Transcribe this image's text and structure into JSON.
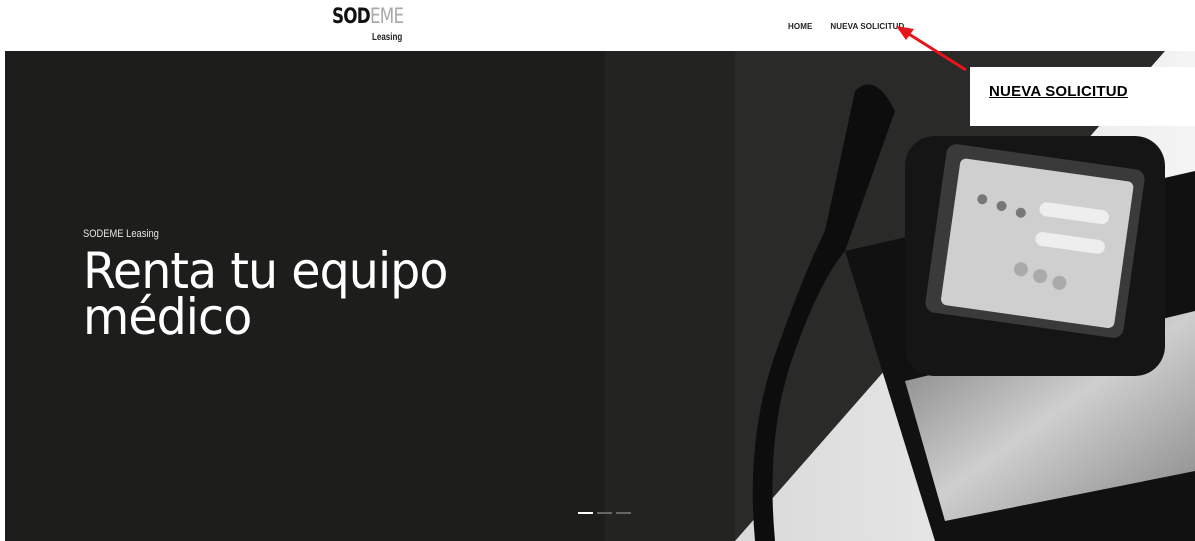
{
  "logo": {
    "main_dark": "SOD",
    "main_light": "EME",
    "sub": "Leasing"
  },
  "nav": {
    "items": [
      {
        "label": "HOME"
      },
      {
        "label": "NUEVA SOLICITUD"
      }
    ]
  },
  "hero": {
    "kicker": "SODEME Leasing",
    "title_line1": "Renta tu equipo",
    "title_line2": "médico"
  },
  "carousel": {
    "slides": 3,
    "active": 1
  },
  "callout": {
    "label": "NUEVA SOLICITUD"
  },
  "colors": {
    "hero_bg": "#1d1d1b",
    "arrow": "#e8141a"
  }
}
